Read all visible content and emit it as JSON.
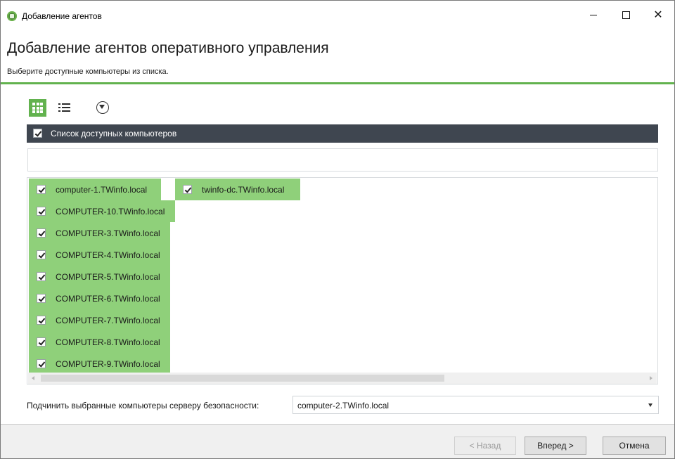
{
  "window": {
    "title": "Добавление агентов"
  },
  "header": {
    "title": "Добавление агентов оперативного управления",
    "subtitle": "Выберите доступные компьютеры из списка."
  },
  "toolbar": {
    "grid_view_icon": "grid-view-icon",
    "list_view_icon": "list-view-icon",
    "filter_icon": "filter-icon"
  },
  "list": {
    "header_label": "Список доступных компьютеров",
    "search_value": "",
    "items": [
      {
        "label": "computer-1.TWinfo.local",
        "checked": true
      },
      {
        "label": "COMPUTER-10.TWinfo.local",
        "checked": true
      },
      {
        "label": "COMPUTER-3.TWinfo.local",
        "checked": true
      },
      {
        "label": "COMPUTER-4.TWinfo.local",
        "checked": true
      },
      {
        "label": "COMPUTER-5.TWinfo.local",
        "checked": true
      },
      {
        "label": "COMPUTER-6.TWinfo.local",
        "checked": true
      },
      {
        "label": "COMPUTER-7.TWinfo.local",
        "checked": true
      },
      {
        "label": "COMPUTER-8.TWinfo.local",
        "checked": true
      },
      {
        "label": "COMPUTER-9.TWinfo.local",
        "checked": true
      },
      {
        "label": "twinfo-dc.TWinfo.local",
        "checked": true
      }
    ]
  },
  "subordinate": {
    "label": "Подчинить выбранные компьютеры серверу безопасности:",
    "selected": "computer-2.TWinfo.local"
  },
  "footer": {
    "back_label": "< Назад",
    "next_label": "Вперед >",
    "cancel_label": "Отмена"
  },
  "colors": {
    "accent": "#62b24e",
    "tile_selected": "#8fd07a",
    "header_bar": "#3f4650"
  }
}
